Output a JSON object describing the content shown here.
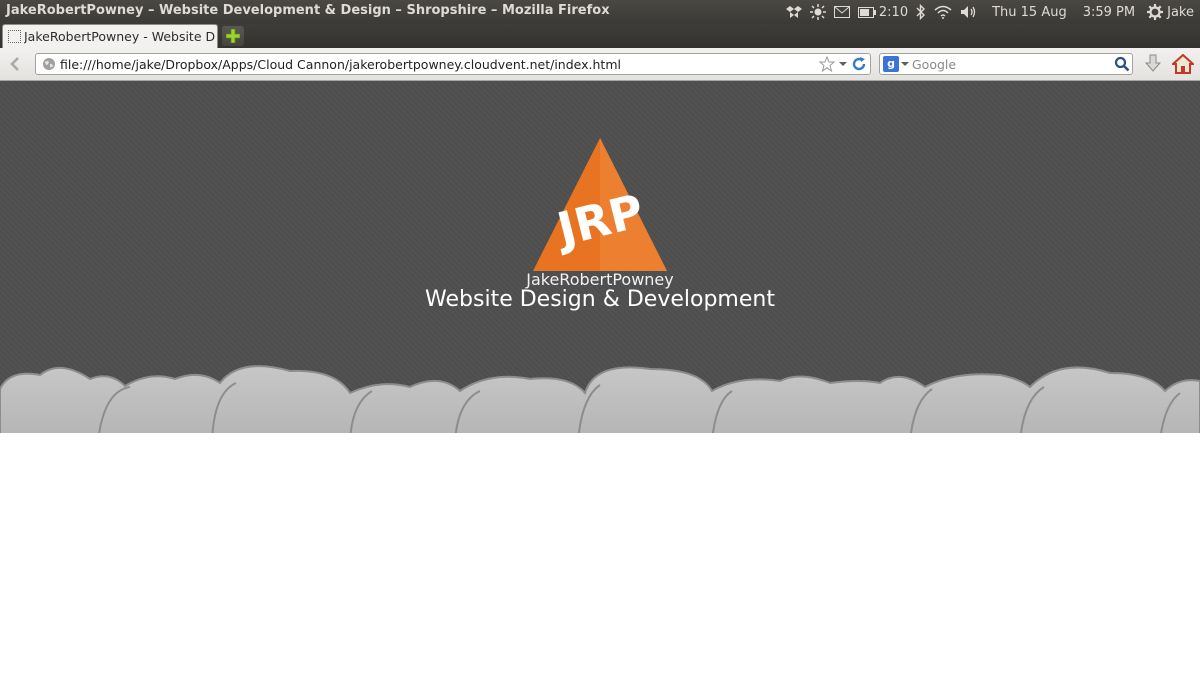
{
  "window": {
    "title": "JakeRobertPowney – Website Development & Design – Shropshire – Mozilla Firefox"
  },
  "tray": {
    "icons": [
      "dropbox-icon",
      "brightness-icon",
      "mail-icon",
      "battery-icon",
      "bluetooth-icon",
      "wifi-icon",
      "volume-icon",
      "gear-icon"
    ],
    "battery_time": "2:10",
    "date": "Thu 15 Aug",
    "time": "3:59 PM",
    "user": "Jake"
  },
  "tabs": [
    {
      "label": "JakeRobertPowney - Website D..."
    }
  ],
  "navbar": {
    "url": "file:///home/jake/Dropbox/Apps/Cloud Cannon/jakerobertpowney.cloudvent.net/index.html",
    "search_placeholder": "Google",
    "search_engine_letter": "g"
  },
  "page": {
    "logo_initials": "JRP",
    "brand_name": "JakeRobertPowney",
    "tagline": "Website Design & Development"
  },
  "colors": {
    "hero_background": "#4f4f4f",
    "logo_orange": "#e87422",
    "cloud_fill": "#bdbdbd",
    "cloud_outline": "#8d8d8d"
  }
}
